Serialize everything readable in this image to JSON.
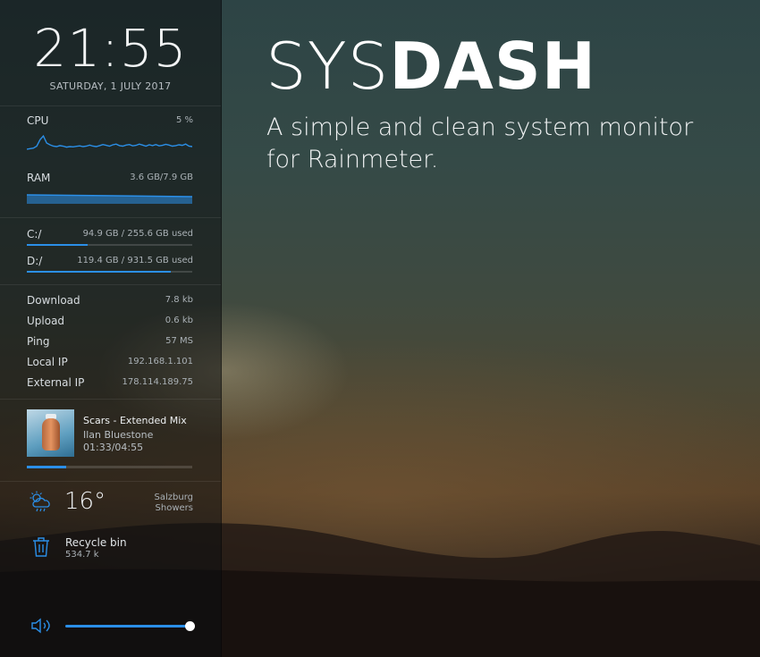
{
  "clock": {
    "time": "21:55",
    "date": "SATURDAY, 1 JULY 2017"
  },
  "cpu": {
    "label": "CPU",
    "value": "5 %",
    "graph_values": [
      18,
      20,
      22,
      30,
      55,
      70,
      42,
      35,
      30,
      28,
      32,
      30,
      26,
      28,
      27,
      29,
      31,
      28,
      30,
      34,
      30,
      28,
      32,
      36,
      33,
      30,
      35,
      38,
      32,
      30,
      34,
      36,
      31,
      33,
      38,
      34,
      30,
      35,
      32,
      36,
      31,
      33,
      37,
      34,
      30,
      32,
      35,
      33,
      38,
      30,
      28
    ]
  },
  "ram": {
    "label": "RAM",
    "value": "3.6 GB/7.9 GB",
    "usage_fraction": 0.46
  },
  "drives": [
    {
      "label": "C:/",
      "value": "94.9 GB / 255.6 GB used",
      "fraction": 0.37
    },
    {
      "label": "D:/",
      "value": "119.4 GB / 931.5 GB used",
      "fraction": 0.87
    }
  ],
  "network": [
    {
      "label": "Download",
      "value": "7.8 kb"
    },
    {
      "label": "Upload",
      "value": "0.6 kb"
    },
    {
      "label": "Ping",
      "value": "57 MS"
    },
    {
      "label": "Local IP",
      "value": "192.168.1.101"
    },
    {
      "label": "External IP",
      "value": "178.114.189.75"
    }
  ],
  "music": {
    "title": "Scars - Extended Mix",
    "artist": "Ilan Bluestone",
    "time": "01:33/04:55",
    "progress_fraction": 0.24
  },
  "weather": {
    "temp": "16°",
    "city": "Salzburg",
    "condition": "Showers",
    "icon": "cloud-rain-sun-icon"
  },
  "recycle": {
    "label": "Recycle bin",
    "size": "534.7 k",
    "icon": "trash-icon"
  },
  "volume": {
    "icon": "speaker-icon",
    "level_fraction": 0.99
  },
  "hero": {
    "title_thin": "SYS",
    "title_bold": "DASH",
    "subtitle_line1": "A simple and clean system monitor",
    "subtitle_line2": "for Rainmeter."
  },
  "colors": {
    "accent": "#2b8fe8",
    "sidebar_bg": "#0c0e10"
  }
}
